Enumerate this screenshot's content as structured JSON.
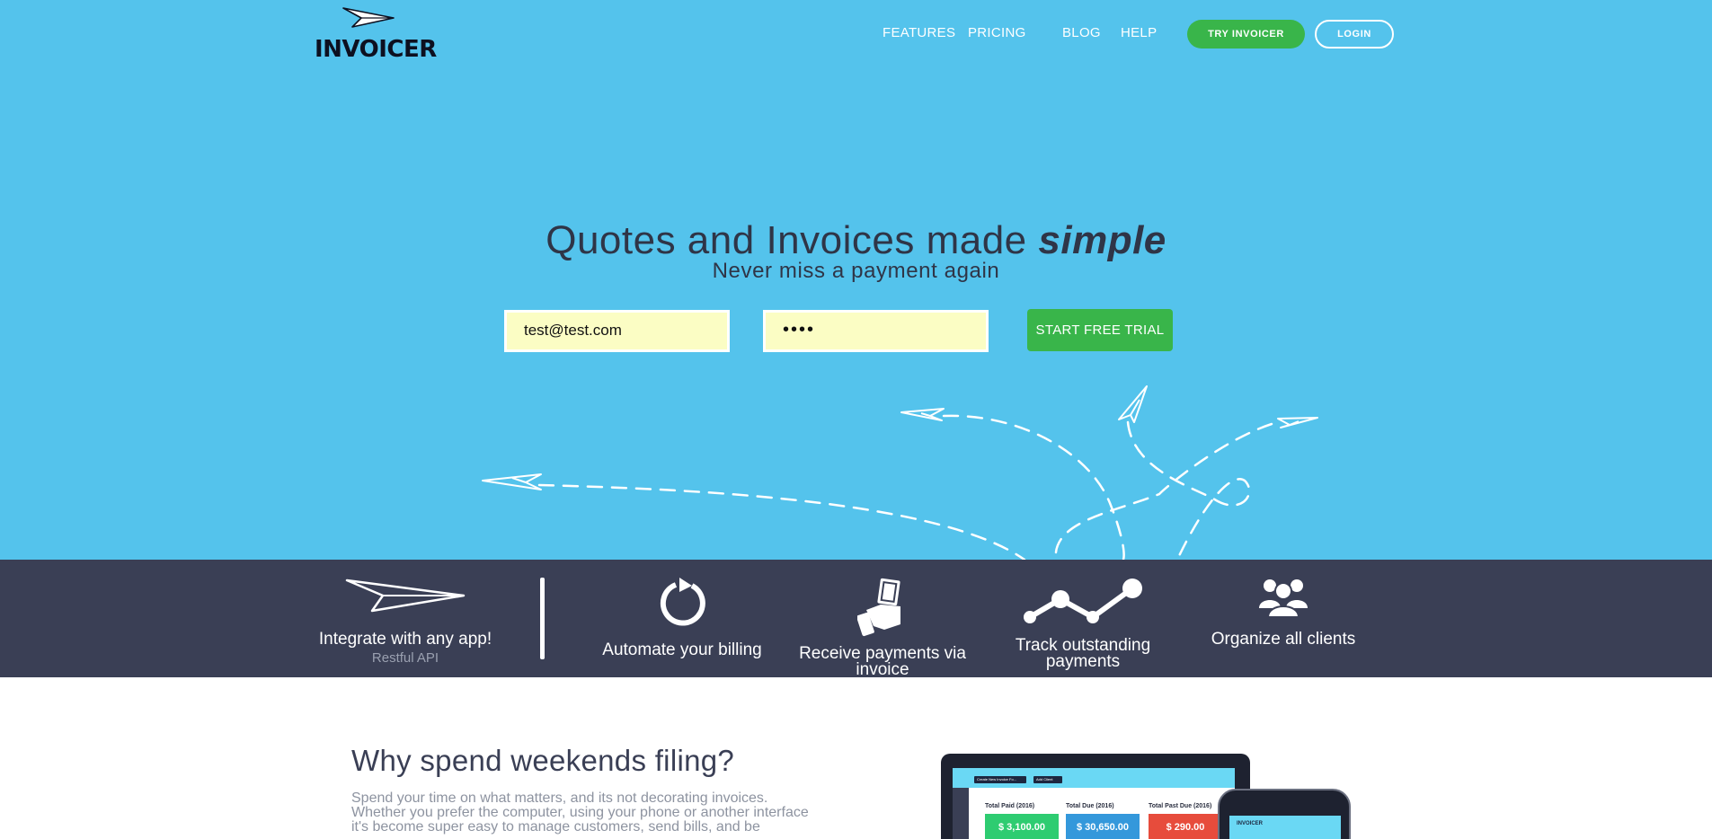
{
  "header": {
    "logo_text": "INVOICER",
    "nav": [
      "FEATURES",
      "PRICING",
      "BLOG",
      "HELP"
    ],
    "try_button": "TRY INVOICER",
    "login_button": "LOGIN"
  },
  "hero": {
    "headline": "Quotes and Invoices made",
    "headline_emphasis": "simple",
    "subheadline": "Never miss a payment again",
    "email_value": "test@test.com",
    "password_value": "••••",
    "cta_button": "START FREE TRIAL"
  },
  "features": [
    {
      "icon": "paper-plane-icon",
      "label": "Integrate with any app!",
      "sub": "Restful API"
    },
    {
      "icon": "refresh-icon",
      "label": "Automate your billing"
    },
    {
      "icon": "hand-money-icon",
      "label": "Receive payments via invoice"
    },
    {
      "icon": "line-chart-icon",
      "label": "Track outstanding payments"
    },
    {
      "icon": "users-group-icon",
      "label": "Organize all clients"
    }
  ],
  "why": {
    "title": "Why spend weekends filing?",
    "body": "Spend your time on what matters, and its not decorating invoices. Whether you prefer the computer, using your phone or another interface it's become super easy to manage customers, send bills, and be"
  },
  "mockup": {
    "toolbar": [
      "Create New Invoice Fo...",
      "Add Client"
    ],
    "cards": [
      {
        "label": "Total Paid (2016)",
        "value": "$ 3,100.00",
        "color": "#2ecc71"
      },
      {
        "label": "Total Due (2016)",
        "value": "$ 30,650.00",
        "color": "#3498db"
      },
      {
        "label": "Total Past Due (2016)",
        "value": "$ 290.00",
        "color": "#e74c3c"
      }
    ],
    "phone_logo": "INVOICER"
  },
  "colors": {
    "hero_bg": "#54c3ec",
    "strip_bg": "#3a3f55",
    "accent_green": "#39b54a",
    "field_bg": "#fbfdc4"
  }
}
